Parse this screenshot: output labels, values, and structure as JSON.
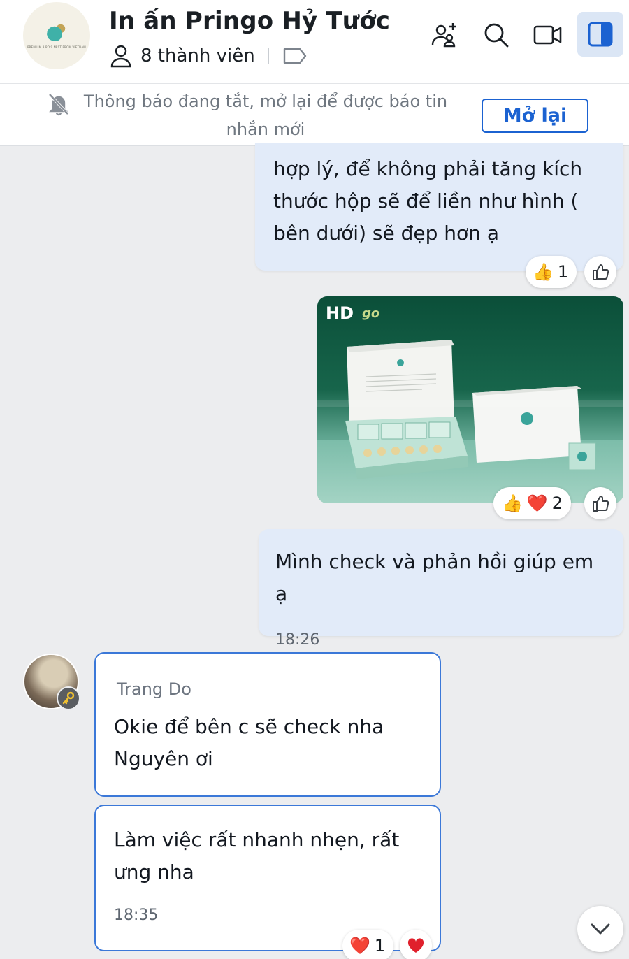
{
  "header": {
    "title": "In ấn Pringo Hỷ Tước",
    "members_label": "8 thành viên",
    "avatar_caption": "PREMIUM BIRD'S NEST FROM VIETNAM",
    "icons": [
      "add-member-icon",
      "search-icon",
      "video-call-icon",
      "sidebar-toggle-icon"
    ]
  },
  "notice": {
    "text": "Thông báo đang tắt, mở lại để được báo tin nhắn mới",
    "button_label": "Mở lại"
  },
  "messages": [
    {
      "id": "m1",
      "mine": true,
      "text": "hợp lý, để không phải tăng kích thước hộp sẽ để liền như hình ( bên dưới) sẽ đẹp hơn ạ",
      "reactions": [
        {
          "emoji": "👍",
          "count": "1"
        }
      ]
    },
    {
      "id": "m2",
      "mine": true,
      "type": "image",
      "badge": "HD",
      "brand_text": "go",
      "reactions": [
        {
          "emoji": "👍"
        },
        {
          "emoji": "❤️",
          "count": "2"
        }
      ]
    },
    {
      "id": "m3",
      "mine": true,
      "text": "Mình check và phản hồi giúp em ạ",
      "time": "18:26"
    },
    {
      "id": "m4",
      "mine": false,
      "sender": "Trang Do",
      "text": "Okie để bên c sẽ check nha Nguyên ơi"
    },
    {
      "id": "m5",
      "mine": false,
      "text": "Làm việc rất nhanh nhẹn, rất ưng nha",
      "time": "18:35",
      "reactions": [
        {
          "emoji": "❤️",
          "count": "1"
        }
      ]
    }
  ],
  "colors": {
    "accent": "#1b62d1",
    "mine_bubble": "#e2ebf9",
    "theirs_border": "#3b78d8",
    "background": "#ecedef"
  }
}
